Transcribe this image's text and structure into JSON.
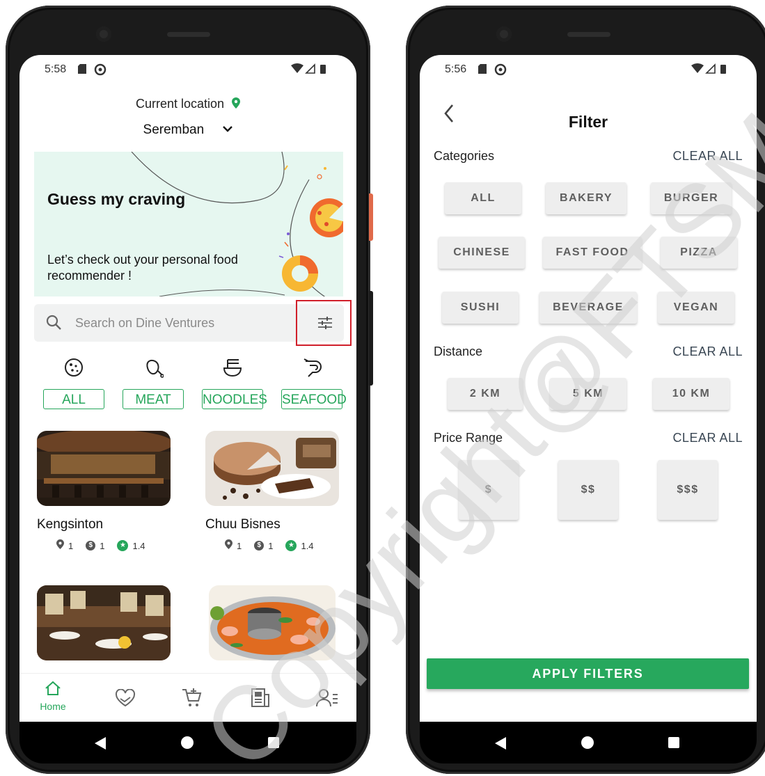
{
  "left": {
    "status": {
      "time": "5:58"
    },
    "location": {
      "title": "Current location",
      "city": "Seremban"
    },
    "banner": {
      "title": "Guess my craving",
      "subtitle": "Let’s check out your personal food recommender !"
    },
    "search": {
      "placeholder": "Search on Dine Ventures"
    },
    "categories": [
      {
        "label": "ALL",
        "icon": "cookie-icon"
      },
      {
        "label": "MEAT",
        "icon": "meat-icon"
      },
      {
        "label": "NOODLES",
        "icon": "noodle-bowl-icon"
      },
      {
        "label": "SEAFOOD",
        "icon": "shrimp-icon"
      }
    ],
    "restaurants": [
      {
        "name": "Kengsinton",
        "distance": "1",
        "price": "1",
        "rating": "1.4"
      },
      {
        "name": "Chuu Bisnes",
        "distance": "1",
        "price": "1",
        "rating": "1.4"
      }
    ],
    "bottom_nav": {
      "home_label": "Home"
    },
    "colors": {
      "accent": "#26a65b",
      "highlight": "#d01f2a",
      "banner_bg": "#e6f7f0"
    }
  },
  "right": {
    "status": {
      "time": "5:56"
    },
    "title": "Filter",
    "sections": {
      "categories": {
        "label": "Categories",
        "clear": "CLEAR ALL"
      },
      "distance": {
        "label": "Distance",
        "clear": "CLEAR ALL"
      },
      "price": {
        "label": "Price Range",
        "clear": "CLEAR ALL"
      }
    },
    "category_chips": [
      "ALL",
      "BAKERY",
      "BURGER",
      "CHINESE",
      "FAST FOOD",
      "PIZZA",
      "SUSHI",
      "BEVERAGE",
      "VEGAN"
    ],
    "distance_chips": [
      "2 KM",
      "5 KM",
      "10 KM"
    ],
    "price_chips": [
      "$",
      "$$",
      "$$$"
    ],
    "apply_label": "APPLY FILTERS",
    "colors": {
      "button": "#27a85d",
      "chip_bg": "#eeeeee"
    }
  },
  "watermark": "Copyright@FTSM UKM"
}
